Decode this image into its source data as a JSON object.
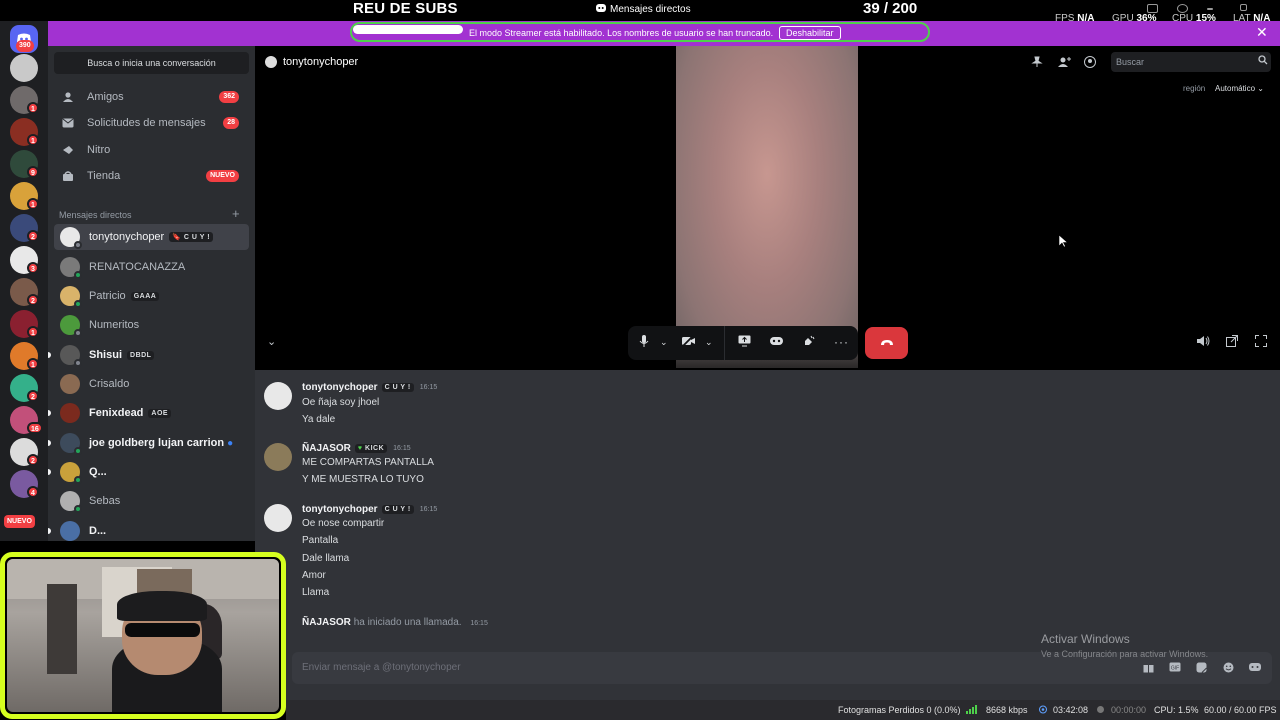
{
  "overlay": {
    "subs_title": "REU DE SUBS",
    "dm_title": "Mensajes directos",
    "subs_count": "39  / 200",
    "fps_label": "FPS",
    "fps_value": "N/A",
    "gpu_label": "GPU",
    "gpu_value": "36%",
    "cpu_label": "CPU",
    "cpu_value": "15%",
    "lat_label": "LAT",
    "lat_value": "N/A"
  },
  "banner": {
    "text": "El modo Streamer está habilitado. Los nombres de usuario se han truncado.",
    "button": "Deshabilitar",
    "color": "#a232d1"
  },
  "rail": {
    "home_badge": "390",
    "badges": [
      "1",
      "1",
      "9",
      "1",
      "2",
      "3",
      "2",
      "1",
      "1",
      "2",
      "16",
      "2",
      "4"
    ],
    "nuevo": "NUEVO"
  },
  "sidebar": {
    "search_placeholder": "Busca o inicia una conversación",
    "nav": [
      {
        "label": "Amigos",
        "badge": "362",
        "icon": "friends-icon"
      },
      {
        "label": "Solicitudes de mensajes",
        "badge": "28",
        "icon": "envelope-icon"
      },
      {
        "label": "Nitro",
        "badge": "",
        "icon": "nitro-icon"
      },
      {
        "label": "Tienda",
        "badge": "NUEVO",
        "icon": "shop-icon"
      }
    ],
    "dm_header": "Mensajes directos",
    "dms": [
      {
        "name": "tonytonychoper",
        "tag": "🔖 C U Y !"
      },
      {
        "name": "RENATOCANAZZA",
        "tag": ""
      },
      {
        "name": "Patricio",
        "tag": "GAAA"
      },
      {
        "name": "Numeritos",
        "tag": ""
      },
      {
        "name": "Shisui",
        "tag": "DBDL"
      },
      {
        "name": "Crisaldo",
        "tag": ""
      },
      {
        "name": "Fenixdead",
        "tag": "AOE"
      },
      {
        "name": "joe goldberg lujan carrion",
        "tag": ""
      },
      {
        "name": "Q...",
        "tag": ""
      },
      {
        "name": "Sebas",
        "tag": ""
      },
      {
        "name": "D...",
        "tag": ""
      }
    ]
  },
  "call": {
    "name": "tonytonychoper",
    "search_placeholder": "Buscar",
    "region_label": "región",
    "region_value": "Automático"
  },
  "chat": {
    "groups": [
      {
        "author": "tonytonychoper",
        "tag": "C U Y !",
        "time": "16:15",
        "lines": [
          "Oe ñaja soy jhoel",
          "Ya dale"
        ]
      },
      {
        "author": "ÑAJASOR",
        "tag": "KICK",
        "time": "16:15",
        "lines": [
          "ME COMPARTAS PANTALLA",
          "Y ME MUESTRA LO TUYO"
        ]
      },
      {
        "author": "tonytonychoper",
        "tag": "C U Y !",
        "time": "16:15",
        "lines": [
          "Oe nose compartir",
          "Pantalla",
          "Dale llama",
          "Amor",
          "Llama"
        ]
      }
    ],
    "system": {
      "author": "ÑAJASOR",
      "text": "ha iniciado una llamada.",
      "time": "16:15"
    },
    "input_placeholder": "Enviar mensaje a @tonytonychoper"
  },
  "windows": {
    "activate_title": "Activar Windows",
    "activate_sub": "Ve a Configuración para activar Windows."
  },
  "statusbar": {
    "frames_dropped": "Fotogramas Perdidos 0 (0.0%)",
    "bitrate": "8668 kbps",
    "stream_time": "03:42:08",
    "rec_time": "00:00:00",
    "cpu": "CPU: 1.5%",
    "fps": "60.00 / 60.00 FPS"
  }
}
